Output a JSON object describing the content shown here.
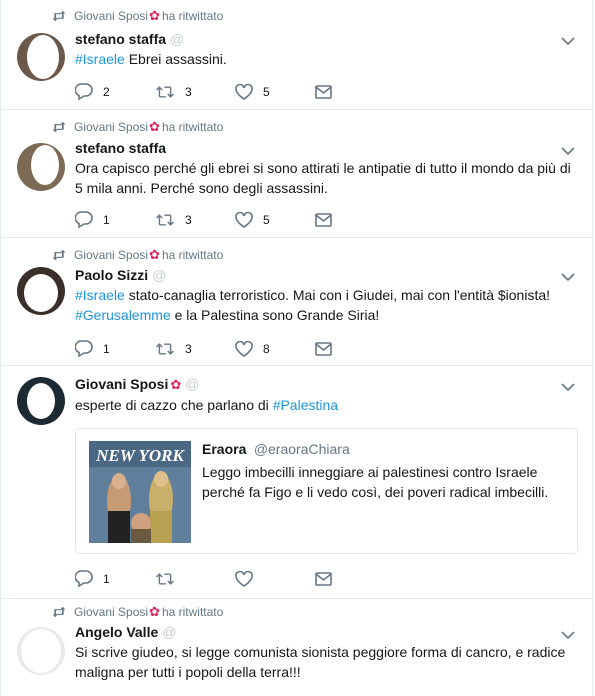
{
  "tweets": [
    {
      "retweet_by": "Giovani Sposi",
      "retweet_suffix": "ha ritwittato",
      "name": "stefano staffa",
      "handle": "@ ",
      "text_parts": [
        {
          "t": "#Israele",
          "tag": true
        },
        {
          "t": " Ebrei assassini.",
          "tag": false
        }
      ],
      "replies": "2",
      "retweets": "3",
      "likes": "5"
    },
    {
      "retweet_by": "Giovani Sposi",
      "retweet_suffix": "ha ritwittato",
      "name": "stefano staffa",
      "handle": "",
      "text_parts": [
        {
          "t": "Ora capisco perché gli ebrei si sono attirati le antipatie di tutto il mondo da più di 5 mila anni. Perché sono degli assassini.",
          "tag": false
        }
      ],
      "replies": "1",
      "retweets": "3",
      "likes": "5"
    },
    {
      "retweet_by": "Giovani Sposi",
      "retweet_suffix": "ha ritwittato",
      "name": "Paolo Sizzi",
      "handle": "@ ",
      "text_parts": [
        {
          "t": "#Israele",
          "tag": true
        },
        {
          "t": " stato-canaglia terroristico. Mai con i Giudei, mai con l'entità $ionista! ",
          "tag": false
        },
        {
          "t": "#Gerusalemme",
          "tag": true
        },
        {
          "t": " e la Palestina sono Grande Siria!",
          "tag": false
        }
      ],
      "replies": "1",
      "retweets": "3",
      "likes": "8"
    },
    {
      "name": "Giovani Sposi",
      "handle": "@ ",
      "text_parts": [
        {
          "t": "esperte di cazzo che parlano di ",
          "tag": false
        },
        {
          "t": "#Palestina",
          "tag": true
        }
      ],
      "quote": {
        "image_caption": "NEW YORK",
        "name": "Eraora",
        "handle": "@eraoraChiara",
        "text": "Leggo imbecilli inneggiare ai palestinesi contro Israele perché fa Figo e li vedo così, dei poveri radical imbecilli."
      },
      "replies": "1",
      "retweets": "",
      "likes": ""
    },
    {
      "retweet_by": "Giovani Sposi",
      "retweet_suffix": "ha ritwittato",
      "name": "Angelo Valle",
      "handle": "@",
      "text_parts": [
        {
          "t": "Si scrive giudeo, si legge comunista sionista peggiore forma di cancro, e radice maligna per tutti i popoli della terra!!!",
          "tag": false
        }
      ]
    }
  ],
  "colors": {
    "accent": "#1b95e0",
    "secondary": "#657786",
    "border": "#e6ecf0",
    "text": "#14171a"
  }
}
